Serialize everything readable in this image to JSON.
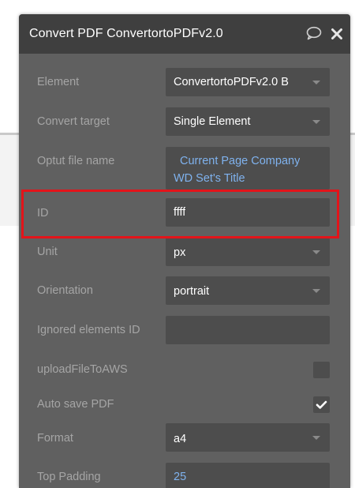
{
  "panel": {
    "title": "Convert PDF ConvertortoPDFv2.0"
  },
  "rows": {
    "element": {
      "label": "Element",
      "value": "ConvertortoPDFv2.0 B"
    },
    "convert_target": {
      "label": "Convert target",
      "value": "Single Element"
    },
    "output_file_name": {
      "label": "Optut file name",
      "value_line1": "Current Page Company",
      "value_line2": "WD Set's Title"
    },
    "id": {
      "label": "ID",
      "value": "ffff"
    },
    "unit": {
      "label": "Unit",
      "value": "px"
    },
    "orientation": {
      "label": "Orientation",
      "value": "portrait"
    },
    "ignored_elements_id": {
      "label": "Ignored elements ID",
      "value": ""
    },
    "upload_file_to_aws": {
      "label": "uploadFileToAWS",
      "checked": false
    },
    "auto_save_pdf": {
      "label": "Auto save PDF",
      "checked": true
    },
    "format": {
      "label": "Format",
      "value": "a4"
    },
    "top_padding": {
      "label": "Top Padding",
      "value": "25"
    }
  },
  "colors": {
    "panel_bg": "#606060",
    "header_bg": "#3f3f3f",
    "field_bg": "#4d4d4d",
    "dynamic_text": "#7fb2ee",
    "highlight": "#e3141a"
  },
  "icons": {
    "comment": "comment-icon",
    "close": "close-icon",
    "dropdown": "chevron-down-icon",
    "check": "checkmark-icon"
  }
}
